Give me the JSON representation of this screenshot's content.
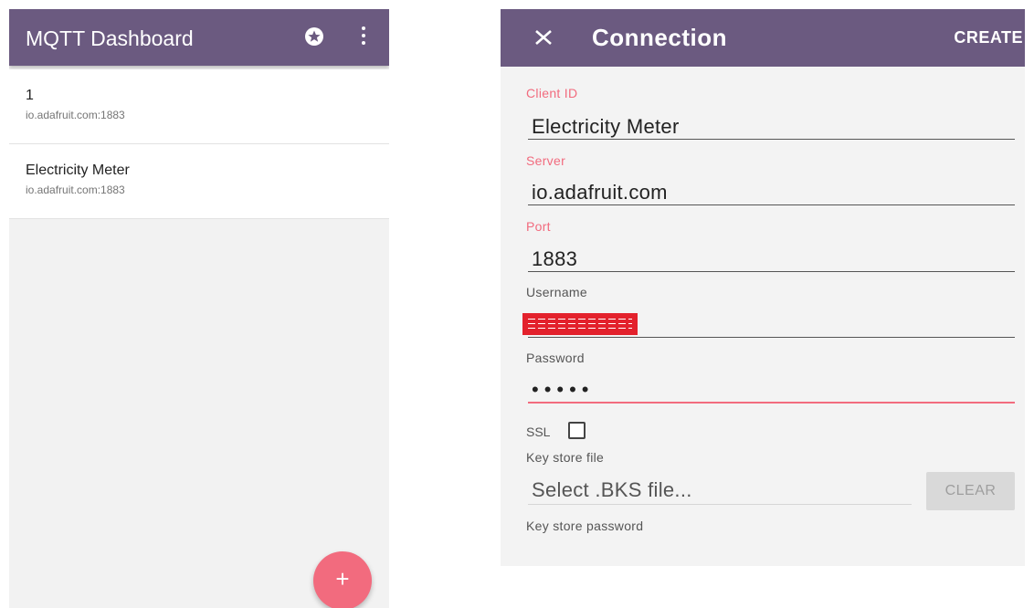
{
  "dashboard": {
    "title": "MQTT Dashboard",
    "icons": {
      "favorite": "star-circle-icon",
      "menu": "more-vertical-icon",
      "add": "plus-icon"
    },
    "connections": [
      {
        "name": "1",
        "server": "io.adafruit.com:1883"
      },
      {
        "name": "Electricity Meter",
        "server": "io.adafruit.com:1883"
      }
    ],
    "fab_label": "+"
  },
  "connection_form": {
    "title": "Connection",
    "create_label": "CREATE",
    "close_icon": "close-icon",
    "client_id": {
      "label": "Client ID",
      "value": "Electricity Meter"
    },
    "server": {
      "label": "Server",
      "value": "io.adafruit.com"
    },
    "port": {
      "label": "Port",
      "value": "1883"
    },
    "username": {
      "label": "Username"
    },
    "password": {
      "label": "Password",
      "value": "•••••"
    },
    "ssl": {
      "label": "SSL",
      "checked": false
    },
    "key_store_file": {
      "label": "Key store file",
      "placeholder": "Select .BKS file...",
      "clear_label": "CLEAR"
    },
    "key_store_password": {
      "label": "Key store password"
    }
  },
  "colors": {
    "app_bar": "#6b5a80",
    "accent": "#f26b7e",
    "background": "#f2f2f2",
    "redaction": "#e3212c"
  }
}
